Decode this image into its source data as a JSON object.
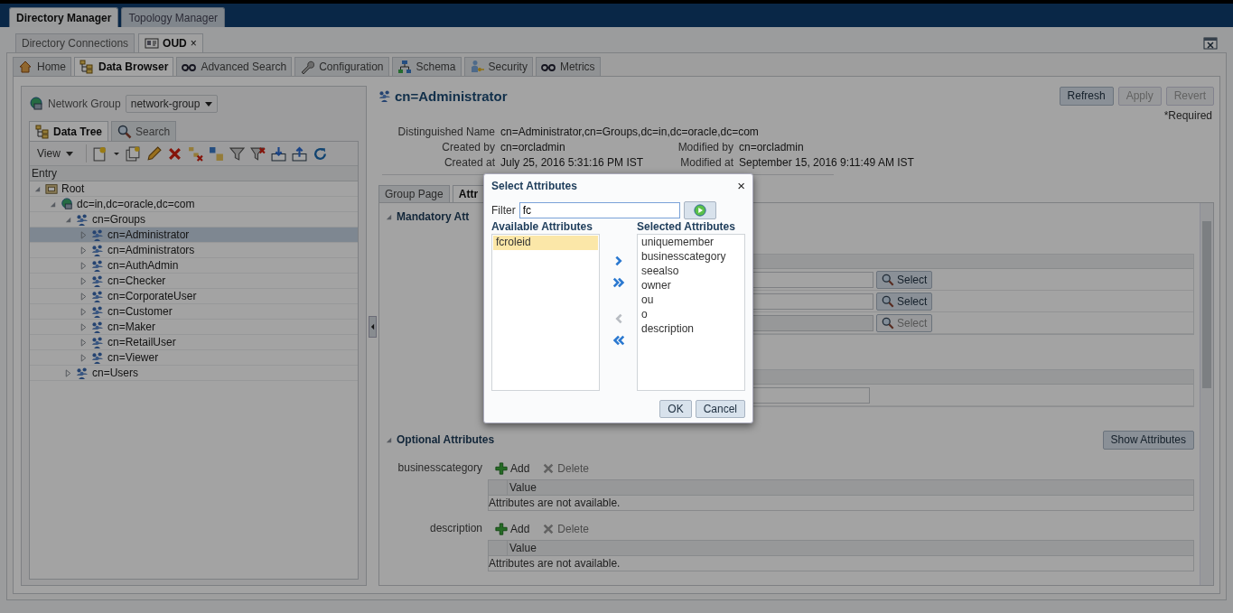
{
  "app_tabs": [
    {
      "label": "Directory Manager",
      "selected": true
    },
    {
      "label": "Topology Manager",
      "selected": false
    }
  ],
  "connection_tabs": [
    {
      "label": "Directory Connections",
      "selected": false
    },
    {
      "label": "OUD",
      "selected": true,
      "close": "×"
    }
  ],
  "nav_tabs": [
    {
      "label": "Home",
      "selected": false
    },
    {
      "label": "Data Browser",
      "selected": true
    },
    {
      "label": "Advanced Search",
      "selected": false
    },
    {
      "label": "Configuration",
      "selected": false
    },
    {
      "label": "Schema",
      "selected": false
    },
    {
      "label": "Security",
      "selected": false
    },
    {
      "label": "Metrics",
      "selected": false
    }
  ],
  "left": {
    "network_group_label": "Network Group",
    "network_group_value": "network-group",
    "tabs": [
      {
        "label": "Data Tree",
        "selected": true
      },
      {
        "label": "Search",
        "selected": false
      }
    ],
    "view_menu": "View",
    "column": "Entry",
    "tree": [
      {
        "label": "Root",
        "kind": "root",
        "expanded": true,
        "selected": false,
        "children": [
          {
            "label": "dc=in,dc=oracle,dc=com",
            "kind": "domain",
            "expanded": true,
            "selected": false,
            "children": [
              {
                "label": "cn=Groups",
                "kind": "group",
                "expanded": true,
                "selected": false,
                "children": [
                  {
                    "label": "cn=Administrator",
                    "kind": "group",
                    "expanded": false,
                    "selected": true
                  },
                  {
                    "label": "cn=Administrators",
                    "kind": "group",
                    "expanded": false,
                    "selected": false
                  },
                  {
                    "label": "cn=AuthAdmin",
                    "kind": "group",
                    "expanded": false,
                    "selected": false
                  },
                  {
                    "label": "cn=Checker",
                    "kind": "group",
                    "expanded": false,
                    "selected": false
                  },
                  {
                    "label": "cn=CorporateUser",
                    "kind": "group",
                    "expanded": false,
                    "selected": false
                  },
                  {
                    "label": "cn=Customer",
                    "kind": "group",
                    "expanded": false,
                    "selected": false
                  },
                  {
                    "label": "cn=Maker",
                    "kind": "group",
                    "expanded": false,
                    "selected": false
                  },
                  {
                    "label": "cn=RetailUser",
                    "kind": "group",
                    "expanded": false,
                    "selected": false
                  },
                  {
                    "label": "cn=Viewer",
                    "kind": "group",
                    "expanded": false,
                    "selected": false
                  }
                ]
              },
              {
                "label": "cn=Users",
                "kind": "group",
                "expanded": false,
                "selected": false
              }
            ]
          }
        ]
      }
    ]
  },
  "entry": {
    "title": "cn=Administrator",
    "buttons": [
      {
        "label": "Refresh",
        "disabled": false
      },
      {
        "label": "Apply",
        "disabled": true
      },
      {
        "label": "Revert",
        "disabled": true
      }
    ],
    "required_note": "*Required",
    "dn_label": "Distinguished Name",
    "dn": "cn=Administrator,cn=Groups,dc=in,dc=oracle,dc=com",
    "created_by_label": "Created by",
    "created_by": "cn=orcladmin",
    "modified_by_label": "Modified by",
    "modified_by": "cn=orcladmin",
    "created_at_label": "Created at",
    "created_at": "July 25, 2016 5:31:16 PM IST",
    "modified_at_label": "Modified at",
    "modified_at": "September 15, 2016 9:11:49 AM IST"
  },
  "detail_tabs": [
    {
      "label": "Group Page",
      "selected": false
    },
    {
      "label": "Attr",
      "selected": true
    }
  ],
  "mandatory": {
    "title": "Mandatory Att",
    "expanded": true,
    "rows": [
      {
        "button": "Select",
        "disabled": false
      },
      {
        "button": "Select",
        "disabled": false
      },
      {
        "button": "Select",
        "disabled": true
      }
    ]
  },
  "optional": {
    "title": "Optional Attributes",
    "expanded": true,
    "show_button": "Show Attributes",
    "attributes": [
      {
        "name": "businesscategory",
        "add": "Add",
        "delete": "Delete",
        "column": "Value",
        "empty": "Attributes are not available."
      },
      {
        "name": "description",
        "add": "Add",
        "delete": "Delete",
        "column": "Value",
        "empty": "Attributes are not available."
      }
    ]
  },
  "dialog": {
    "title": "Select Attributes",
    "close": "×",
    "filter_label": "Filter",
    "filter_value": "fc",
    "available_title": "Available Attributes",
    "available": [
      {
        "label": "fcroleid",
        "selected": true
      }
    ],
    "selected_title": "Selected Attributes",
    "selected_items": [
      {
        "label": "uniquemember",
        "selected": false
      },
      {
        "label": "businesscategory",
        "selected": false
      },
      {
        "label": "seealso",
        "selected": false
      },
      {
        "label": "owner",
        "selected": false
      },
      {
        "label": "ou",
        "selected": false
      },
      {
        "label": "o",
        "selected": false
      },
      {
        "label": "description",
        "selected": false
      }
    ],
    "moves": [
      {
        "kind": "move",
        "disabled": false
      },
      {
        "kind": "move_all",
        "disabled": false
      },
      {
        "kind": "remove",
        "disabled": true
      },
      {
        "kind": "remove_all",
        "disabled": false
      }
    ],
    "buttons": [
      "OK",
      "Cancel"
    ]
  }
}
